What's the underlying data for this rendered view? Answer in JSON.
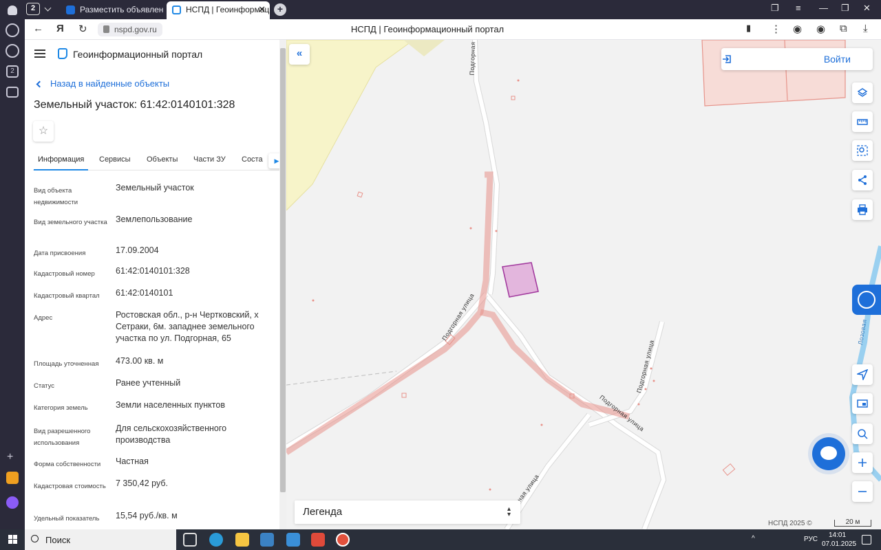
{
  "browser": {
    "tab_count": "2",
    "tabs": [
      {
        "title": "Разместить объявление о"
      },
      {
        "title": "НСПД | Геоинформацио"
      }
    ],
    "url": "nspd.gov.ru",
    "page_title": "НСПД | Геоинформационный портал"
  },
  "panel": {
    "portal_name": "Геоинформационный портал",
    "back_label": "Назад в найденные объекты",
    "object_title": "Земельный участок: 61:42:0140101:328",
    "tabs": [
      "Информация",
      "Сервисы",
      "Объекты",
      "Части ЗУ",
      "Соста"
    ],
    "rows": [
      {
        "label": "Вид объекта недвижимости",
        "value": "Земельный участок"
      },
      {
        "label": "Вид земельного участка",
        "value": "Землепользование"
      },
      {
        "label": "Дата присвоения",
        "value": "17.09.2004"
      },
      {
        "label": "Кадастровый номер",
        "value": "61:42:0140101:328"
      },
      {
        "label": "Кадастровый квартал",
        "value": "61:42:0140101"
      },
      {
        "label": "Адрес",
        "value": "Ростовская обл., р-н Чертковский, х Сетраки, 6м. западнее земельного участка по ул. Подгорная, 65"
      },
      {
        "label": "Площадь уточненная",
        "value": "473.00 кв. м"
      },
      {
        "label": "Статус",
        "value": "Ранее учтенный"
      },
      {
        "label": "Категория земель",
        "value": "Земли населенных пунктов"
      },
      {
        "label": "Вид разрешенного использования",
        "value": "Для сельскохозяйственного производства"
      },
      {
        "label": "Форма собственности",
        "value": "Частная"
      },
      {
        "label": "Кадастровая стоимость",
        "value": "7 350,42 руб."
      },
      {
        "label": "Удельный показатель",
        "value": "15,54 руб./кв. м"
      }
    ]
  },
  "map": {
    "login_label": "Войти",
    "legend_label": "Легенда",
    "copyright": "НСПД 2025 ©",
    "scale": "20 м",
    "street_labels": [
      "Подгорная",
      "Подгорная  улица",
      "Подгорная  улица",
      "Подгорная  улица",
      "Подгорная  улица",
      "Лозовая"
    ],
    "colors": {
      "parcel_fill": "#e3b6dd",
      "parcel_stroke": "#a23a9e",
      "road_outline": "#e8928a",
      "accent": "#1e6fd9"
    }
  },
  "taskbar": {
    "search_label": "Поиск",
    "language": "РУС",
    "time": "14:01",
    "date": "07.01.2025"
  }
}
